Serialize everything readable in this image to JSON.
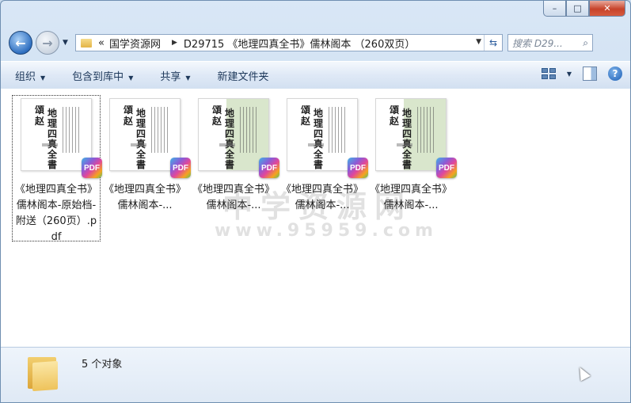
{
  "window": {
    "controls": {
      "minimize": "–",
      "maximize": "□",
      "close": "✕"
    }
  },
  "nav": {
    "back_icon": "back-arrow-icon",
    "forward_icon": "forward-arrow-icon",
    "overflow": "«",
    "breadcrumbs": [
      "国学资源网",
      "D29715 《地理四真全书》儒林阁本 （260双页）"
    ],
    "search_placeholder": "搜索 D29..."
  },
  "toolbar": {
    "organize": "组织",
    "include_in_library": "包含到库中",
    "share": "共享",
    "new_folder": "新建文件夹"
  },
  "files": [
    {
      "name": "《地理四真全书》儒林阁本-原始档-附送（260页）.pdf",
      "selected": true,
      "thumb_tint": "white",
      "badge": "PDF",
      "thumb_text": [
        "頌",
        "赵",
        "地理四真全書"
      ]
    },
    {
      "name": "《地理四真全书》儒林阁本-...",
      "selected": false,
      "thumb_tint": "white",
      "badge": "PDF",
      "thumb_text": [
        "頌",
        "赵",
        "地理四真全書"
      ]
    },
    {
      "name": "《地理四真全书》儒林阁本-...",
      "selected": false,
      "thumb_tint": "green",
      "badge": "PDF",
      "thumb_text": [
        "頌",
        "赵",
        "地理四真全書"
      ]
    },
    {
      "name": "《地理四真全书》儒林阁本-...",
      "selected": false,
      "thumb_tint": "white",
      "badge": "PDF",
      "thumb_text": [
        "頌",
        "赵",
        "地理四真全書"
      ]
    },
    {
      "name": "《地理四真全书》儒林阁本-...",
      "selected": false,
      "thumb_tint": "green",
      "badge": "PDF",
      "thumb_text": [
        "頌",
        "赵",
        "地理四真全書"
      ]
    }
  ],
  "watermark": {
    "line1": "中学资源网",
    "line2": "www.95959.com"
  },
  "status": {
    "count": "5 个对象"
  }
}
